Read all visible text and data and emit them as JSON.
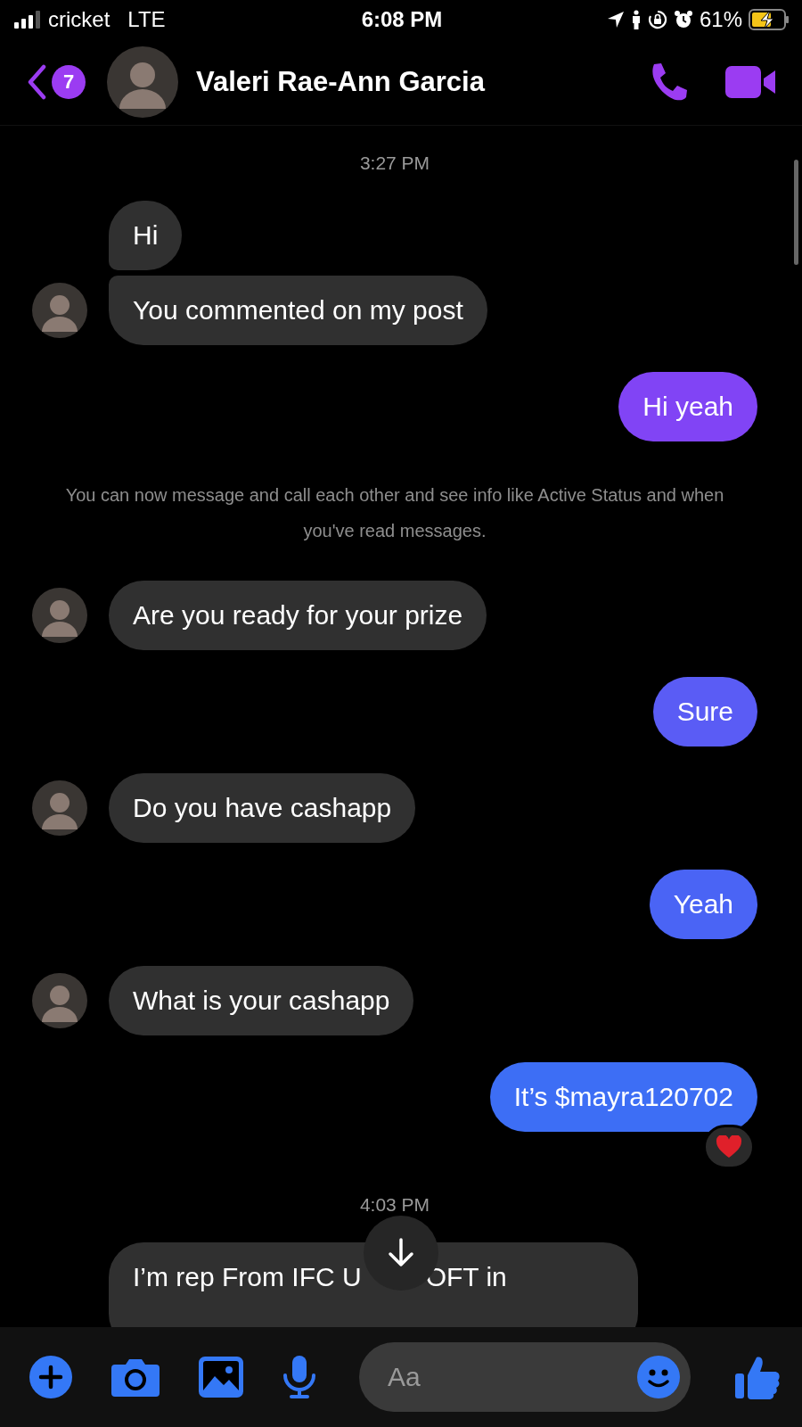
{
  "status_bar": {
    "carrier": "cricket",
    "network": "LTE",
    "time": "6:08 PM",
    "battery": "61%"
  },
  "header": {
    "back_badge": "7",
    "contact_name": "Valeri Rae-Ann Garcia"
  },
  "messages": [
    {
      "kind": "timestamp",
      "text": "3:27 PM"
    },
    {
      "kind": "incoming",
      "text": "Hi",
      "avatar": false,
      "joined_below": true,
      "joined_above": false
    },
    {
      "kind": "incoming",
      "text": "You commented on my post",
      "avatar": true,
      "joined_below": false,
      "joined_above": true
    },
    {
      "kind": "outgoing",
      "text": "Hi yeah",
      "color": "#8144f5"
    },
    {
      "kind": "notice",
      "text": "You can now message and call each other and see info like Active Status and when you've read messages."
    },
    {
      "kind": "incoming",
      "text": "Are you ready for your prize",
      "avatar": true,
      "joined_below": false,
      "joined_above": false
    },
    {
      "kind": "outgoing",
      "text": "Sure",
      "color": "#5a5cf5"
    },
    {
      "kind": "incoming",
      "text": "Do you have cashapp",
      "avatar": true,
      "joined_below": false,
      "joined_above": false
    },
    {
      "kind": "outgoing",
      "text": "Yeah",
      "color": "#4a64f5"
    },
    {
      "kind": "incoming",
      "text": "What is your cashapp",
      "avatar": true,
      "joined_below": false,
      "joined_above": false
    },
    {
      "kind": "outgoing",
      "text": "It’s $mayra120702",
      "color": "#3d6ef5",
      "reaction": true
    },
    {
      "kind": "timestamp",
      "text": "4:03 PM"
    },
    {
      "kind": "incoming",
      "text": "I’m rep From IFC U",
      "text_after": "OFT in",
      "avatar": false,
      "joined_below": false,
      "joined_above": false,
      "covered": true
    }
  ],
  "composer": {
    "placeholder": "Aa"
  }
}
